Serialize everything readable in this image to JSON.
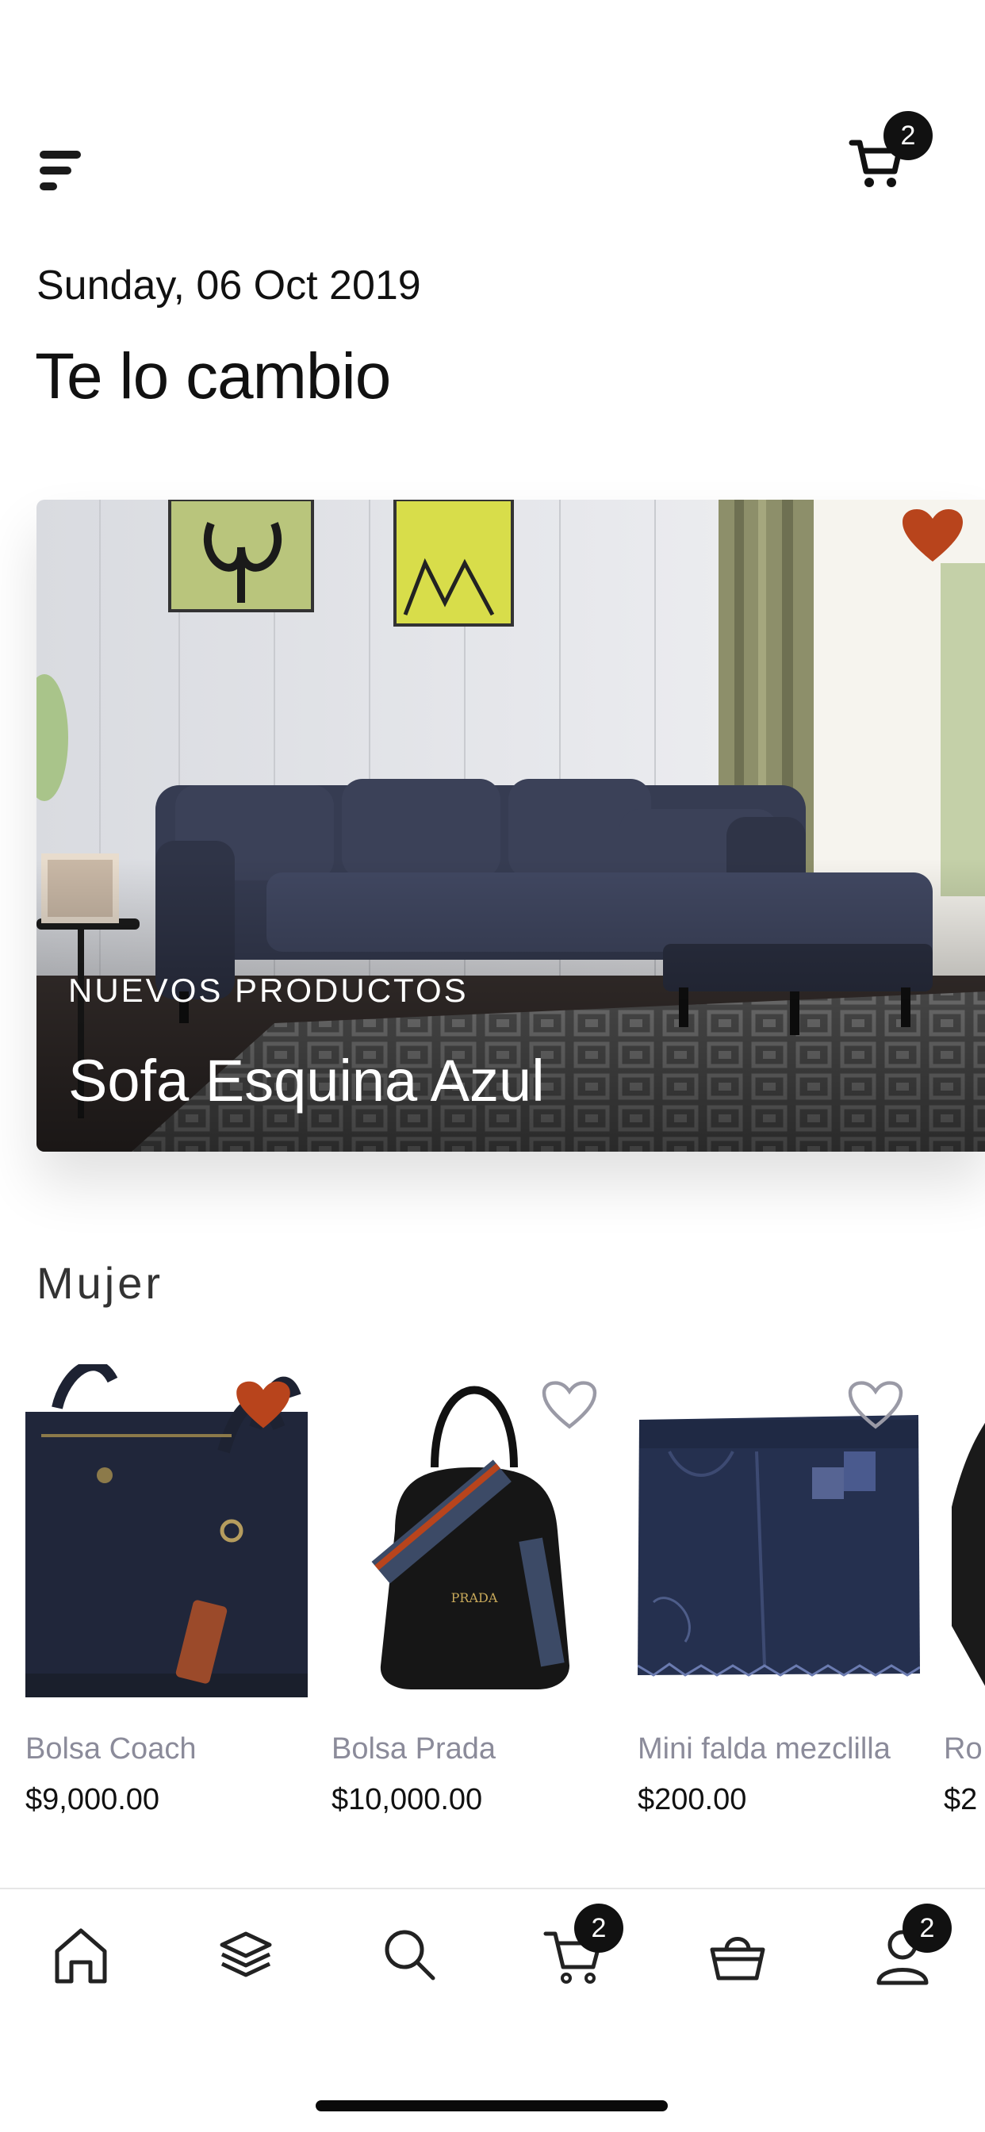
{
  "header": {
    "menu_icon": "hamburger-menu-icon",
    "cart_icon": "cart-icon",
    "cart_count": "2",
    "date": "Sunday, 06 Oct 2019",
    "title": "Te lo cambio"
  },
  "hero": {
    "label": "NUEVOS PRODUCTOS",
    "title": "Sofa Esquina Azul",
    "favorited": true
  },
  "section": {
    "title": "Mujer"
  },
  "products": [
    {
      "name": "Bolsa Coach",
      "price": "$9,000.00",
      "favorited": true
    },
    {
      "name": "Bolsa Prada",
      "price": "$10,000.00",
      "favorited": false
    },
    {
      "name": "Mini falda mezclilla",
      "price": "$200.00",
      "favorited": false
    },
    {
      "name": "Ro",
      "price": "$2",
      "favorited": false
    }
  ],
  "tabbar": {
    "items": [
      {
        "icon": "home-icon"
      },
      {
        "icon": "layers-icon"
      },
      {
        "icon": "search-icon"
      },
      {
        "icon": "cart-icon",
        "badge": "2"
      },
      {
        "icon": "basket-icon"
      },
      {
        "icon": "user-icon",
        "badge": "2"
      }
    ]
  },
  "colors": {
    "accent": "#b8441c",
    "text": "#111111",
    "muted": "#8b8b9a"
  }
}
